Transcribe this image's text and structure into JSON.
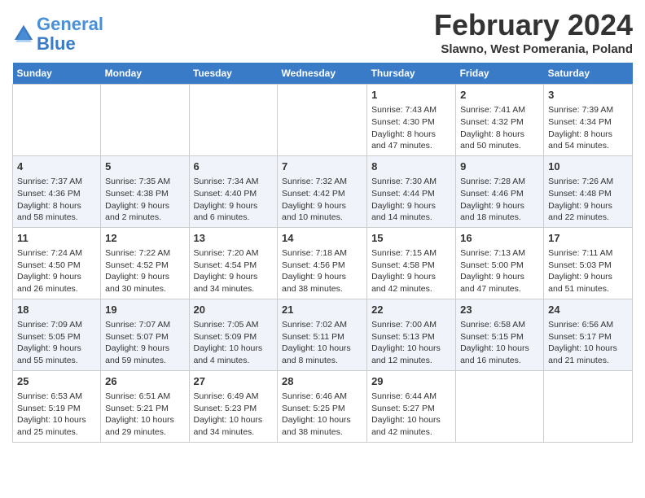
{
  "header": {
    "logo_line1": "General",
    "logo_line2": "Blue",
    "month": "February 2024",
    "location": "Slawno, West Pomerania, Poland"
  },
  "weekdays": [
    "Sunday",
    "Monday",
    "Tuesday",
    "Wednesday",
    "Thursday",
    "Friday",
    "Saturday"
  ],
  "weeks": [
    [
      {
        "day": "",
        "info": ""
      },
      {
        "day": "",
        "info": ""
      },
      {
        "day": "",
        "info": ""
      },
      {
        "day": "",
        "info": ""
      },
      {
        "day": "1",
        "info": "Sunrise: 7:43 AM\nSunset: 4:30 PM\nDaylight: 8 hours\nand 47 minutes."
      },
      {
        "day": "2",
        "info": "Sunrise: 7:41 AM\nSunset: 4:32 PM\nDaylight: 8 hours\nand 50 minutes."
      },
      {
        "day": "3",
        "info": "Sunrise: 7:39 AM\nSunset: 4:34 PM\nDaylight: 8 hours\nand 54 minutes."
      }
    ],
    [
      {
        "day": "4",
        "info": "Sunrise: 7:37 AM\nSunset: 4:36 PM\nDaylight: 8 hours\nand 58 minutes."
      },
      {
        "day": "5",
        "info": "Sunrise: 7:35 AM\nSunset: 4:38 PM\nDaylight: 9 hours\nand 2 minutes."
      },
      {
        "day": "6",
        "info": "Sunrise: 7:34 AM\nSunset: 4:40 PM\nDaylight: 9 hours\nand 6 minutes."
      },
      {
        "day": "7",
        "info": "Sunrise: 7:32 AM\nSunset: 4:42 PM\nDaylight: 9 hours\nand 10 minutes."
      },
      {
        "day": "8",
        "info": "Sunrise: 7:30 AM\nSunset: 4:44 PM\nDaylight: 9 hours\nand 14 minutes."
      },
      {
        "day": "9",
        "info": "Sunrise: 7:28 AM\nSunset: 4:46 PM\nDaylight: 9 hours\nand 18 minutes."
      },
      {
        "day": "10",
        "info": "Sunrise: 7:26 AM\nSunset: 4:48 PM\nDaylight: 9 hours\nand 22 minutes."
      }
    ],
    [
      {
        "day": "11",
        "info": "Sunrise: 7:24 AM\nSunset: 4:50 PM\nDaylight: 9 hours\nand 26 minutes."
      },
      {
        "day": "12",
        "info": "Sunrise: 7:22 AM\nSunset: 4:52 PM\nDaylight: 9 hours\nand 30 minutes."
      },
      {
        "day": "13",
        "info": "Sunrise: 7:20 AM\nSunset: 4:54 PM\nDaylight: 9 hours\nand 34 minutes."
      },
      {
        "day": "14",
        "info": "Sunrise: 7:18 AM\nSunset: 4:56 PM\nDaylight: 9 hours\nand 38 minutes."
      },
      {
        "day": "15",
        "info": "Sunrise: 7:15 AM\nSunset: 4:58 PM\nDaylight: 9 hours\nand 42 minutes."
      },
      {
        "day": "16",
        "info": "Sunrise: 7:13 AM\nSunset: 5:00 PM\nDaylight: 9 hours\nand 47 minutes."
      },
      {
        "day": "17",
        "info": "Sunrise: 7:11 AM\nSunset: 5:03 PM\nDaylight: 9 hours\nand 51 minutes."
      }
    ],
    [
      {
        "day": "18",
        "info": "Sunrise: 7:09 AM\nSunset: 5:05 PM\nDaylight: 9 hours\nand 55 minutes."
      },
      {
        "day": "19",
        "info": "Sunrise: 7:07 AM\nSunset: 5:07 PM\nDaylight: 9 hours\nand 59 minutes."
      },
      {
        "day": "20",
        "info": "Sunrise: 7:05 AM\nSunset: 5:09 PM\nDaylight: 10 hours\nand 4 minutes."
      },
      {
        "day": "21",
        "info": "Sunrise: 7:02 AM\nSunset: 5:11 PM\nDaylight: 10 hours\nand 8 minutes."
      },
      {
        "day": "22",
        "info": "Sunrise: 7:00 AM\nSunset: 5:13 PM\nDaylight: 10 hours\nand 12 minutes."
      },
      {
        "day": "23",
        "info": "Sunrise: 6:58 AM\nSunset: 5:15 PM\nDaylight: 10 hours\nand 16 minutes."
      },
      {
        "day": "24",
        "info": "Sunrise: 6:56 AM\nSunset: 5:17 PM\nDaylight: 10 hours\nand 21 minutes."
      }
    ],
    [
      {
        "day": "25",
        "info": "Sunrise: 6:53 AM\nSunset: 5:19 PM\nDaylight: 10 hours\nand 25 minutes."
      },
      {
        "day": "26",
        "info": "Sunrise: 6:51 AM\nSunset: 5:21 PM\nDaylight: 10 hours\nand 29 minutes."
      },
      {
        "day": "27",
        "info": "Sunrise: 6:49 AM\nSunset: 5:23 PM\nDaylight: 10 hours\nand 34 minutes."
      },
      {
        "day": "28",
        "info": "Sunrise: 6:46 AM\nSunset: 5:25 PM\nDaylight: 10 hours\nand 38 minutes."
      },
      {
        "day": "29",
        "info": "Sunrise: 6:44 AM\nSunset: 5:27 PM\nDaylight: 10 hours\nand 42 minutes."
      },
      {
        "day": "",
        "info": ""
      },
      {
        "day": "",
        "info": ""
      }
    ]
  ]
}
